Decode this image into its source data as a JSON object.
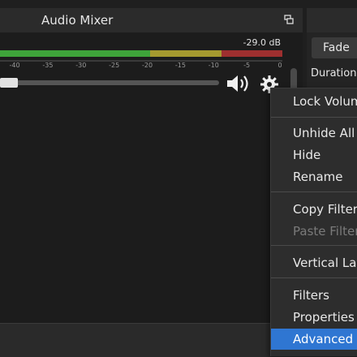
{
  "mixer": {
    "title": "Audio Mixer",
    "db_readout": "-29.0 dB",
    "volume_fraction": 0.02,
    "ticks": [
      "-40",
      "-35",
      "-30",
      "-25",
      "-20",
      "-15",
      "-10",
      "-5",
      "0"
    ]
  },
  "transitions": {
    "fade_label": "Fade",
    "duration_label": "Duration"
  },
  "context_menu": {
    "items": [
      {
        "label": "Lock Volume",
        "disabled": false
      },
      {
        "label": "Unhide All",
        "disabled": false
      },
      {
        "label": "Hide",
        "disabled": false
      },
      {
        "label": "Rename",
        "disabled": false
      },
      {
        "label": "Copy Filters",
        "disabled": false
      },
      {
        "label": "Paste Filters",
        "disabled": true
      },
      {
        "label": "Vertical Layout",
        "disabled": false
      },
      {
        "label": "Filters",
        "disabled": false
      },
      {
        "label": "Properties",
        "disabled": false
      },
      {
        "label": "Advanced Audio Properties",
        "disabled": false,
        "selected": true
      }
    ]
  },
  "colors": {
    "meter_green": "#3ea33a",
    "meter_yellow": "#a59a2f",
    "meter_red": "#9e2f2f",
    "menu_highlight": "#2f76d2"
  },
  "icons": [
    "undock-icon",
    "speaker-icon",
    "gear-icon"
  ]
}
